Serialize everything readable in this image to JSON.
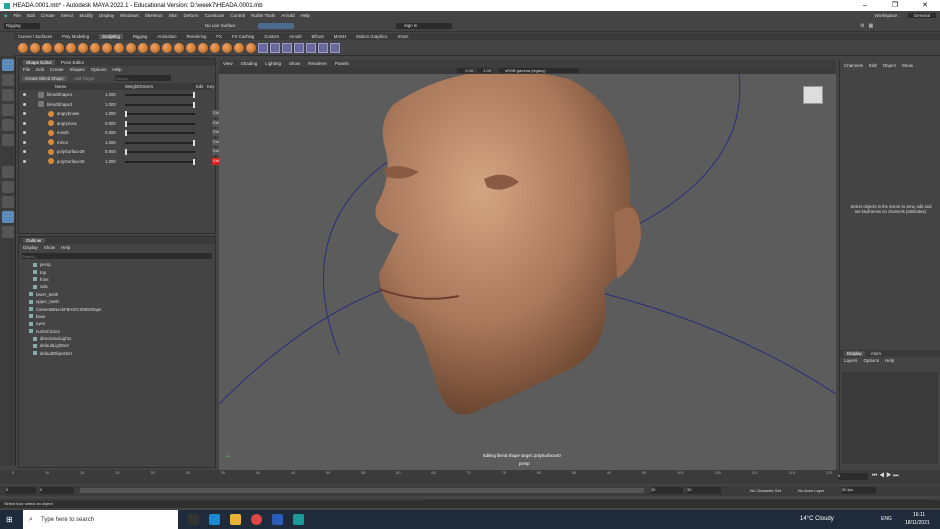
{
  "window": {
    "title": "HEADA.0001.mb* - Autodesk MAYA 2022.1 - Educational Version: D:\\week7\\HEADA.0001.mb",
    "min": "–",
    "max": "❐",
    "close": "✕"
  },
  "menubar": [
    "File",
    "Edit",
    "Create",
    "Select",
    "Modify",
    "Display",
    "Windows",
    "Skeleton",
    "Skin",
    "Deform",
    "Constrain",
    "Control",
    "Nurbs Tools",
    "Arnold",
    "Help"
  ],
  "workspace": {
    "label": "Workspace :",
    "value": "General"
  },
  "status": {
    "mode": "Rigging",
    "live": "No Live Surface",
    "signin": "Sign In"
  },
  "shelf_tabs": [
    "Curves / Surfaces",
    "Poly Modeling",
    "Sculpting",
    "Rigging",
    "Animation",
    "Rendering",
    "FX",
    "FX Caching",
    "Custom",
    "Arnold",
    "Bifrost",
    "MASH",
    "Motion Graphics",
    "XGen"
  ],
  "shelf_active": "Sculpting",
  "shape_editor": {
    "tabs": [
      "Shape Editor",
      "Pose Editor"
    ],
    "menu": [
      "File",
      "Edit",
      "Create",
      "Shapes",
      "Options",
      "Help"
    ],
    "create_btn": "Create Blend Shape",
    "add_btn": "Add Target",
    "search_placeholder": "Search...",
    "headers": {
      "name": "Name",
      "weight": "Weight/Drivers",
      "edit": "Edit",
      "key": "Key"
    },
    "rows": [
      {
        "name": "blendShape1",
        "value": "1.000",
        "slider": 1.0,
        "edit": "",
        "indent": 0
      },
      {
        "name": "blendShape3",
        "value": "1.000",
        "slider": 1.0,
        "edit": "",
        "indent": 0
      },
      {
        "name": "angrybrows",
        "value": "1.000",
        "slider": 0.0,
        "edit": "Edit",
        "indent": 1
      },
      {
        "name": "angrynose",
        "value": "0.000",
        "slider": 0.0,
        "edit": "Edit",
        "indent": 1
      },
      {
        "name": "mouth",
        "value": "0.000",
        "slider": 0.0,
        "edit": "Edit",
        "indent": 1
      },
      {
        "name": "mirror",
        "value": "1.000",
        "slider": 1.0,
        "edit": "Edit",
        "indent": 1
      },
      {
        "name": "polySurface39",
        "value": "0.000",
        "slider": 0.0,
        "edit": "Edit",
        "indent": 1
      },
      {
        "name": "polySurface40",
        "value": "1.000",
        "slider": 1.0,
        "edit": "Edit",
        "indent": 1,
        "active": true
      }
    ]
  },
  "outliner": {
    "title": "Outliner",
    "menu": [
      "Display",
      "Show",
      "Help"
    ],
    "search_placeholder": "Search...",
    "items": [
      "persp",
      "top",
      "front",
      "side",
      "lower_teeth",
      "upper_teeth",
      "CameraBNeckFBASICSMDShape",
      "base",
      "eyes",
      "nurbsCircle1",
      "directionalLight1",
      "defaultLightSet",
      "defaultObjectSet"
    ]
  },
  "viewport": {
    "menu": [
      "View",
      "Shading",
      "Lighting",
      "Show",
      "Renderer",
      "Panels"
    ],
    "heading": "Symmetry: Object X",
    "gamma": "sRGB gamma (legacy)",
    "field1": "0.00",
    "field2": "1.00",
    "footer": "Editing blend shape target: polySurface40",
    "camera": "persp",
    "colors": {
      "skin_light": "#c99a77",
      "skin_dark": "#7a4f35",
      "bg": "#5c5c5c"
    }
  },
  "channelbox": {
    "menu": [
      "Channels",
      "Edit",
      "Object",
      "Show"
    ],
    "empty_msg": "Select objects in the scene to view, edit and set keyframes on channels (attributes)."
  },
  "layers": {
    "tabs": [
      "Display",
      "Anim"
    ],
    "menu": [
      "Layers",
      "Options",
      "Help"
    ]
  },
  "timeslider": {
    "ticks": [
      "5",
      "10",
      "15",
      "20",
      "25",
      "30",
      "35",
      "40",
      "45",
      "50",
      "55",
      "60",
      "65",
      "70",
      "75",
      "80",
      "85",
      "90",
      "95",
      "100",
      "105",
      "110",
      "115",
      "120"
    ],
    "current": "0"
  },
  "range": {
    "start": "0",
    "start2": "0",
    "end": "30",
    "end2": "30",
    "current": "1",
    "charset": "No Character Set",
    "animlayer": "No Anim Layer",
    "fps": "30 fps"
  },
  "cmdline": {
    "label": "MEL"
  },
  "helpline": "Select tool: select an object",
  "taskbar": {
    "search": "Type here to search",
    "weather": "14°C  Cloudy",
    "time": "16:11",
    "date": "18/11/2021",
    "lang": "ENG"
  }
}
